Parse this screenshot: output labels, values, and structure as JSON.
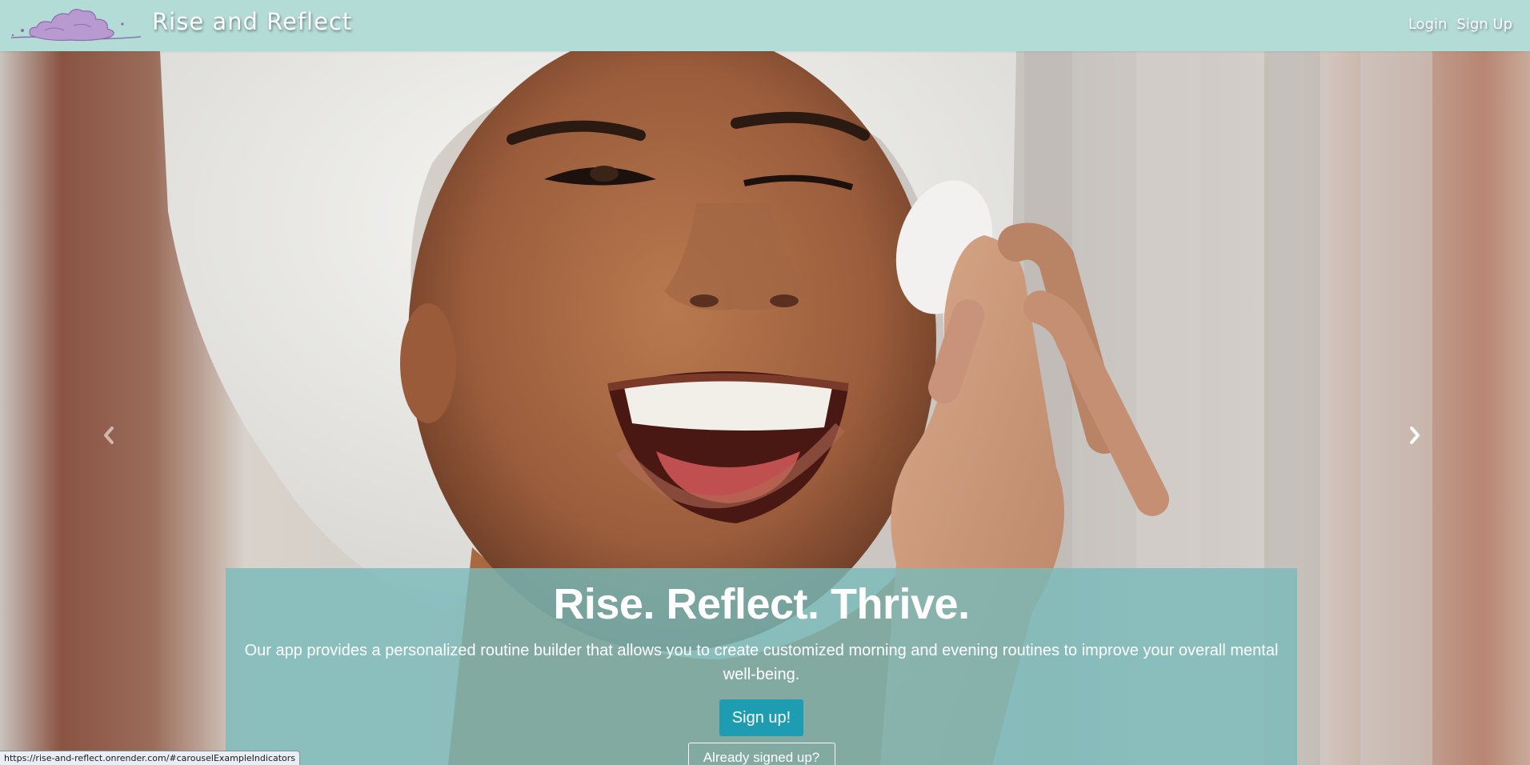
{
  "brand": {
    "logo_icon": "cloud-logo-icon",
    "name": "Rise and Reflect"
  },
  "nav": {
    "login": "Login",
    "signup": "Sign Up"
  },
  "carousel": {
    "prev_icon": "chevron-left-icon",
    "next_icon": "chevron-right-icon",
    "slide_image": "smiling woman with towel on head holding cotton pad"
  },
  "hero": {
    "title": "Rise. Reflect. Thrive.",
    "description": "Our app provides a personalized routine builder that allows you to create customized morning and evening routines to improve your overall mental well-being.",
    "signup_button": "Sign up!",
    "already_button": "Already signed up?"
  },
  "status_bar": {
    "url": "https://rise-and-reflect.onrender.com/#carouselExampleIndicators"
  },
  "colors": {
    "navbar": "#b4dcd7",
    "caption_overlay": "#78baba",
    "signup_button": "#1e9db2"
  }
}
